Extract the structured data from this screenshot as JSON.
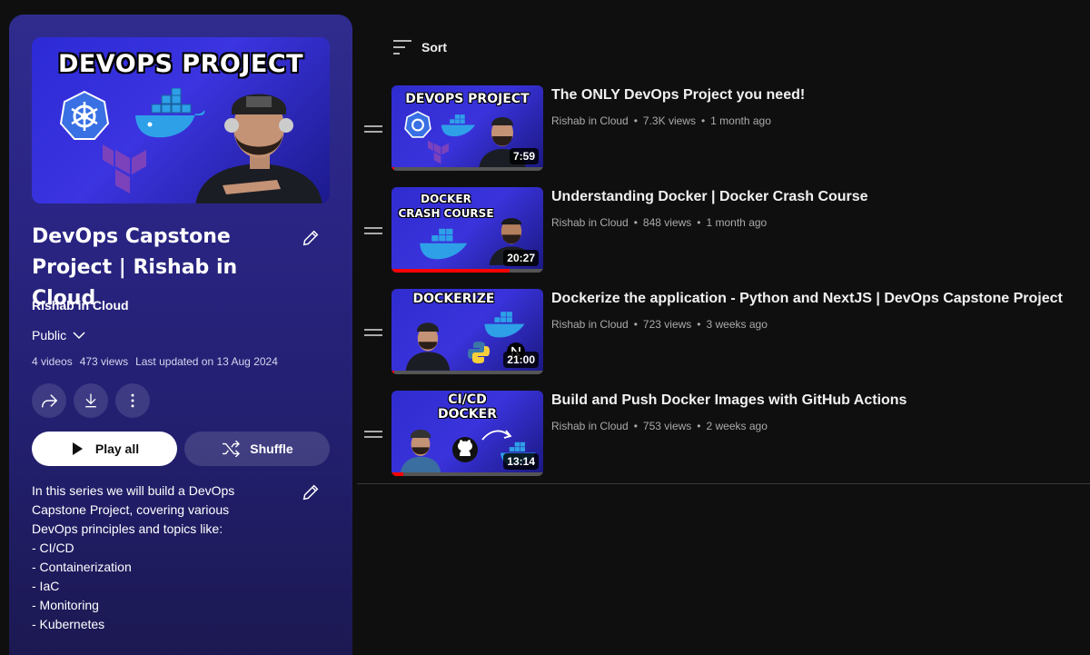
{
  "playlist": {
    "hero_title": "DEVOPS PROJECT",
    "title": "DevOps Capstone Project | Rishab in Cloud",
    "owner": "Rishab in Cloud",
    "privacy": "Public",
    "video_count": "4 videos",
    "views": "473 views",
    "last_updated": "Last updated on 13 Aug 2024",
    "play_all_label": "Play all",
    "shuffle_label": "Shuffle",
    "description_lines": [
      "In this series we will build a DevOps",
      "Capstone Project, covering various",
      "DevOps principles and topics like:",
      "- CI/CD",
      "- Containerization",
      "- IaC",
      "- Monitoring",
      "- Kubernetes"
    ]
  },
  "sort_label": "Sort",
  "videos": [
    {
      "title": "The ONLY DevOps Project you need!",
      "channel": "Rishab in Cloud",
      "views": "7.3K views",
      "age": "1 month ago",
      "duration": "7:59",
      "thumb_text": "DEVOPS PROJECT",
      "watched": 0.02
    },
    {
      "title": "Understanding Docker | Docker Crash Course",
      "channel": "Rishab in Cloud",
      "views": "848 views",
      "age": "1 month ago",
      "duration": "20:27",
      "thumb_text_1": "DOCKER",
      "thumb_text_2": "CRASH COURSE",
      "watched": 0.78
    },
    {
      "title": "Dockerize the application - Python and NextJS | DevOps Capstone Project",
      "channel": "Rishab in Cloud",
      "views": "723 views",
      "age": "3 weeks ago",
      "duration": "21:00",
      "thumb_text": "DOCKERIZE",
      "watched": 0.02
    },
    {
      "title": "Build and Push Docker Images with GitHub Actions",
      "channel": "Rishab in Cloud",
      "views": "753 views",
      "age": "2 weeks ago",
      "duration": "13:14",
      "thumb_text_1": "CI/CD",
      "thumb_text_2": "DOCKER",
      "watched": 0.08
    }
  ],
  "meta_separator": "•",
  "colors": {
    "panel_top": "#2f2c8e",
    "panel_bottom": "#1b1850",
    "progress": "#ff0000",
    "page_bg": "#0f0f0f"
  },
  "icons": [
    "pencil-icon",
    "chevron-down-icon",
    "share-icon",
    "download-icon",
    "more-vert-icon",
    "play-icon",
    "shuffle-icon",
    "sort-icon",
    "drag-handle-icon"
  ]
}
